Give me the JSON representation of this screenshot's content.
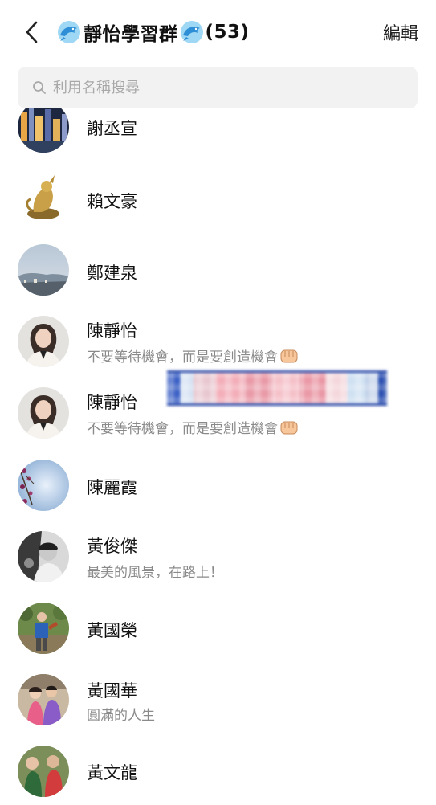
{
  "header": {
    "back_icon": "chevron-left-icon",
    "title_text": "靜怡學習群",
    "member_count": "(53)",
    "edit_label": "編輯"
  },
  "search": {
    "placeholder": "利用名稱搜尋",
    "value": ""
  },
  "members": [
    {
      "name": "謝丞宣",
      "status": ""
    },
    {
      "name": "賴文豪",
      "status": ""
    },
    {
      "name": "鄭建泉",
      "status": ""
    },
    {
      "name": "陳靜怡",
      "status": "不要等待機會，而是要創造機會"
    },
    {
      "name": "陳靜怡",
      "status": "不要等待機會，而是要創造機會"
    },
    {
      "name": "陳麗霞",
      "status": ""
    },
    {
      "name": "黃俊傑",
      "status": "最美的風景，在路上！"
    },
    {
      "name": "黃國榮",
      "status": ""
    },
    {
      "name": "黃國華",
      "status": "圓滿的人生"
    },
    {
      "name": "黃文龍",
      "status": ""
    }
  ],
  "colors": {
    "background": "#ffffff",
    "search_bg": "#f2f2f2",
    "secondary_text": "#8a8a8a"
  }
}
